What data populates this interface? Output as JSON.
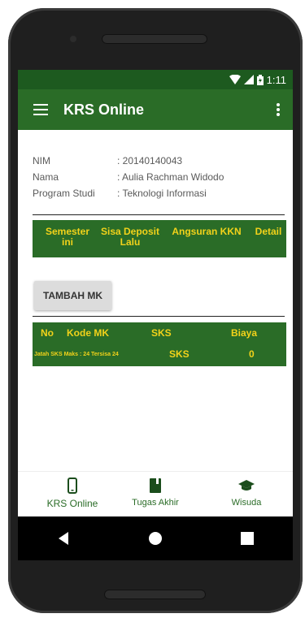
{
  "status_bar": {
    "time": "1:11"
  },
  "app_bar": {
    "title": "KRS Online"
  },
  "student": {
    "nim_label": "NIM",
    "nim_value": ": 20140140043",
    "name_label": "Nama",
    "name_value": ": Aulia Rachman Widodo",
    "program_label": "Program Studi",
    "program_value": ": Teknologi Informasi"
  },
  "semester_table": {
    "headers": [
      "Semester ini",
      "Sisa Deposit Lalu",
      "Angsuran KKN",
      "Detail"
    ]
  },
  "add_course_button": "TAMBAH MK",
  "course_table": {
    "headers": [
      "No",
      "Kode MK",
      "SKS",
      "Biaya"
    ],
    "footer_quota": "Jatah SKS Maks : 24 Tersisa 24",
    "footer_unit": "SKS",
    "footer_total": "0"
  },
  "bottom_nav": {
    "items": [
      {
        "label": "KRS Online",
        "icon": "phone-icon"
      },
      {
        "label": "Tugas Akhir",
        "icon": "book-icon"
      },
      {
        "label": "Wisuda",
        "icon": "graduation-cap-icon"
      }
    ]
  },
  "colors": {
    "primary": "#2a6c27",
    "primary_dark": "#1d5a1f",
    "accent_text": "#f2d21a"
  }
}
